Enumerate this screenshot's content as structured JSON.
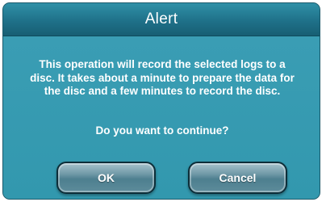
{
  "dialog": {
    "title": "Alert",
    "message": "This operation will record the selected logs to a disc. It takes about a minute to prepare the data for the disc and a few minutes to record the disc.",
    "question": "Do you want to continue?",
    "buttons": {
      "ok_label": "OK",
      "cancel_label": "Cancel"
    }
  },
  "colors": {
    "titlebar": "#1f7189",
    "body": "#3a9db4",
    "button": "#6f98a6",
    "text": "#ffffff"
  }
}
